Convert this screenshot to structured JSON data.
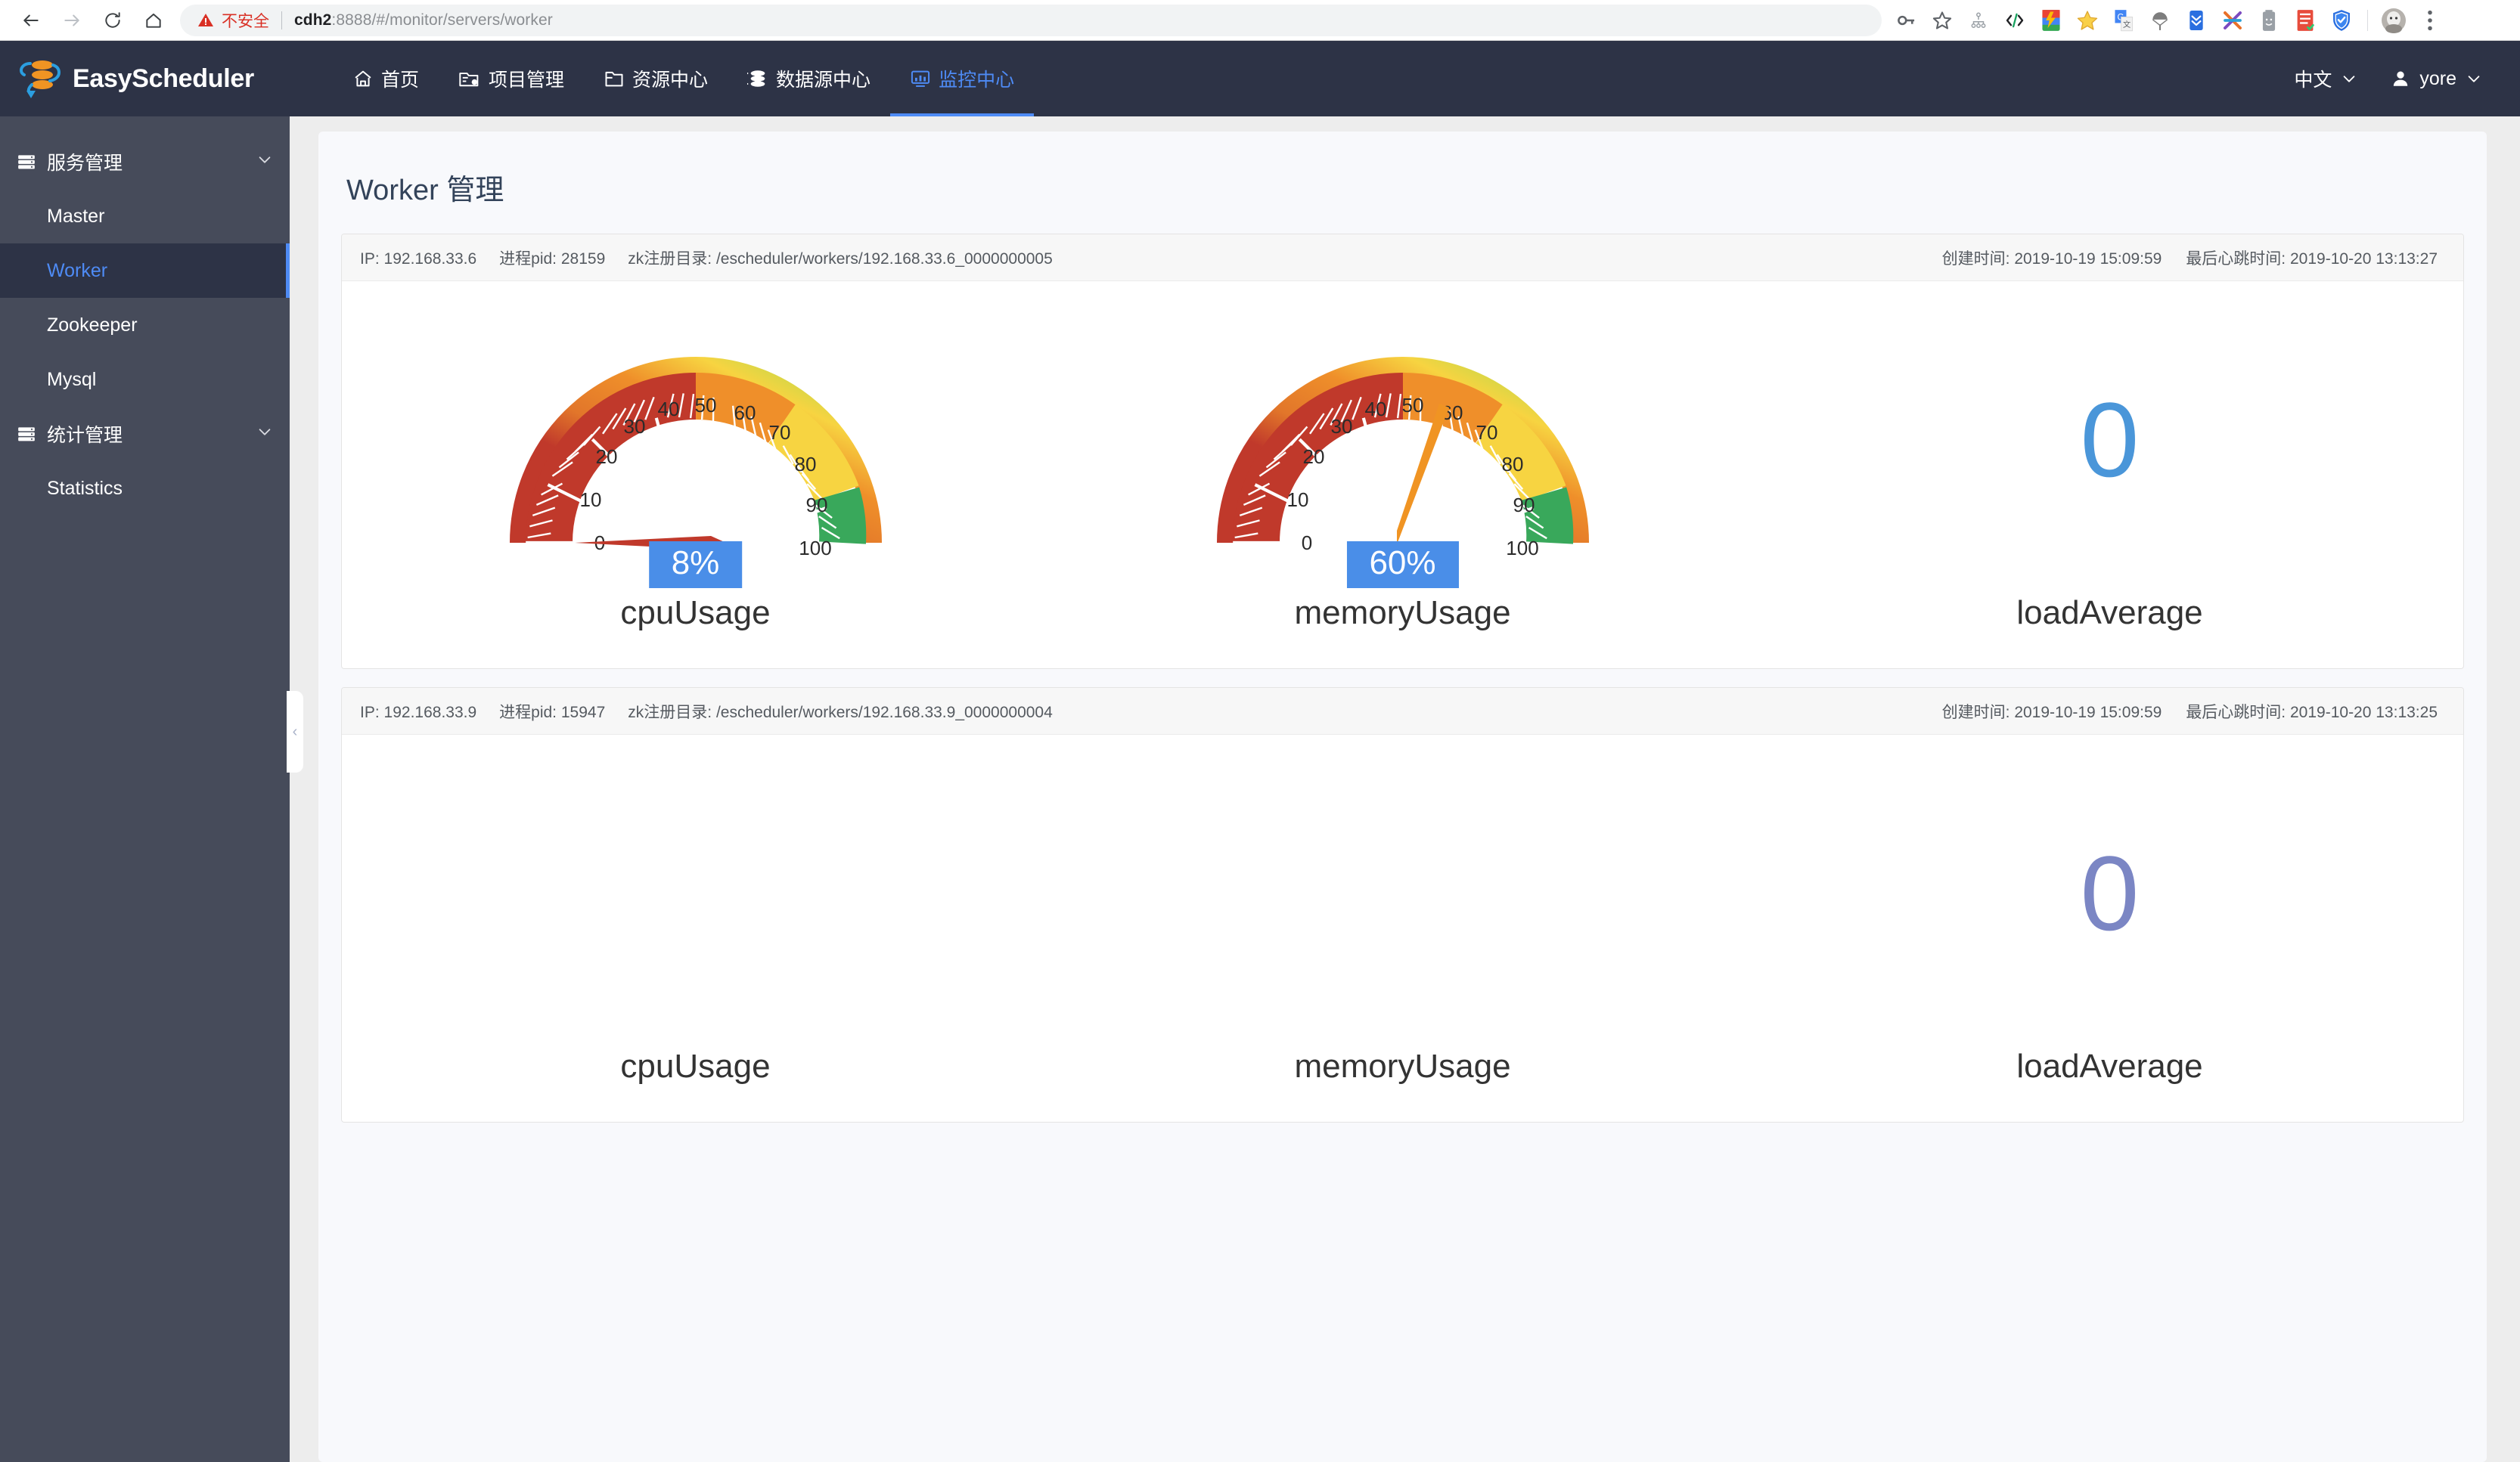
{
  "browser": {
    "back_icon": "back-arrow-icon",
    "forward_icon": "forward-arrow-icon",
    "reload_icon": "reload-icon",
    "home_icon": "home-icon",
    "security_label": "不安全",
    "url_host": "cdh2",
    "url_rest": ":8888/#/monitor/servers/worker",
    "extensions": [
      {
        "name": "password-key-icon",
        "color": "#5f6368"
      },
      {
        "name": "bookmark-star-icon",
        "color": "#5f6368"
      },
      {
        "name": "sitemap-icon",
        "color": "#9aa0a6"
      },
      {
        "name": "code-brackets-icon",
        "color": "#202124"
      },
      {
        "name": "colorzilla-extension-icon",
        "color": "#ea4335"
      },
      {
        "name": "star-extension-icon",
        "color": "#f6c443"
      },
      {
        "name": "google-translate-icon",
        "color": "#4285f4"
      },
      {
        "name": "parachute-extension-icon",
        "color": "#6b6b6b"
      },
      {
        "name": "download-chevrons-icon",
        "color": "#2a6fe0"
      },
      {
        "name": "x-scissors-extension-icon",
        "color": "#e86c2b"
      },
      {
        "name": "battery-extension-icon",
        "color": "#9aa0a6"
      },
      {
        "name": "notes-extension-icon",
        "color": "#e74c3c"
      },
      {
        "name": "shield-extension-icon",
        "color": "#2a6fe0"
      }
    ],
    "avatar_icon": "profile-avatar-icon",
    "menu_icon": "three-dot-menu-icon"
  },
  "header": {
    "brand": "EasyScheduler",
    "nav": [
      {
        "label": "首页",
        "icon": "home-icon",
        "active": false
      },
      {
        "label": "项目管理",
        "icon": "project-folder-gear-icon",
        "active": false
      },
      {
        "label": "资源中心",
        "icon": "folder-icon",
        "active": false
      },
      {
        "label": "数据源中心",
        "icon": "database-icon",
        "active": false
      },
      {
        "label": "监控中心",
        "icon": "monitor-screen-icon",
        "active": true
      }
    ],
    "language": "中文",
    "user": "yore",
    "accent_color": "#4e8bf5",
    "bg_color": "#2d3346"
  },
  "sidebar": {
    "groups": [
      {
        "label": "服务管理",
        "icon": "server-rack-icon",
        "items": [
          {
            "label": "Master",
            "active": false
          },
          {
            "label": "Worker",
            "active": true
          },
          {
            "label": "Zookeeper",
            "active": false
          },
          {
            "label": "Mysql",
            "active": false
          }
        ]
      },
      {
        "label": "统计管理",
        "icon": "server-rack-icon",
        "items": [
          {
            "label": "Statistics",
            "active": false
          }
        ]
      }
    ],
    "collapse_handle": "‹"
  },
  "main": {
    "title": "Worker 管理",
    "labels": {
      "ip": "IP:",
      "pid": "进程pid:",
      "zk": "zk注册目录:",
      "created": "创建时间:",
      "heartbeat": "最后心跳时间:"
    },
    "workers": [
      {
        "ip": "192.168.33.6",
        "pid": "28159",
        "zk_path": "/escheduler/workers/192.168.33.6_0000000005",
        "created_time": "2019-10-19 15:09:59",
        "last_heartbeat": "2019-10-20 13:13:27",
        "metrics": [
          {
            "name": "cpuUsage",
            "value": 8,
            "display": "8%",
            "type": "gauge",
            "needle_color": "#c0392b"
          },
          {
            "name": "memoryUsage",
            "value": 60,
            "display": "60%",
            "type": "gauge",
            "needle_color": "#f09423"
          },
          {
            "name": "loadAverage",
            "value": "0",
            "display": "0",
            "type": "number",
            "color": "#4a96d9"
          }
        ]
      },
      {
        "ip": "192.168.33.9",
        "pid": "15947",
        "zk_path": "/escheduler/workers/192.168.33.9_0000000004",
        "created_time": "2019-10-19 15:09:59",
        "last_heartbeat": "2019-10-20 13:13:25",
        "metrics": [
          {
            "name": "cpuUsage",
            "value": null,
            "display": "",
            "type": "empty",
            "needle_color": ""
          },
          {
            "name": "memoryUsage",
            "value": null,
            "display": "",
            "type": "empty",
            "needle_color": ""
          },
          {
            "name": "loadAverage",
            "value": "0",
            "display": "0",
            "type": "number",
            "color": "#7b86c4"
          }
        ]
      }
    ]
  },
  "chart_data": [
    {
      "type": "gauge",
      "title": "cpuUsage",
      "worker": "192.168.33.6",
      "value": 8,
      "display": "8%",
      "min": 0,
      "max": 100,
      "tick_labels": [
        0,
        10,
        20,
        30,
        40,
        50,
        60,
        70,
        80,
        90,
        100
      ],
      "start_angle": 210,
      "end_angle": -30,
      "bands": [
        {
          "from": 0,
          "to": 50,
          "color": "#c0392b"
        },
        {
          "from": 50,
          "to": 70,
          "color": "#ef8f2a"
        },
        {
          "from": 70,
          "to": 90,
          "color": "#f7d441"
        },
        {
          "from": 90,
          "to": 100,
          "color": "#39a85b"
        }
      ]
    },
    {
      "type": "gauge",
      "title": "memoryUsage",
      "worker": "192.168.33.6",
      "value": 60,
      "display": "60%",
      "min": 0,
      "max": 100,
      "tick_labels": [
        0,
        10,
        20,
        30,
        40,
        50,
        60,
        70,
        80,
        90,
        100
      ],
      "start_angle": 210,
      "end_angle": -30,
      "bands": [
        {
          "from": 0,
          "to": 50,
          "color": "#c0392b"
        },
        {
          "from": 50,
          "to": 70,
          "color": "#ef8f2a"
        },
        {
          "from": 70,
          "to": 90,
          "color": "#f7d441"
        },
        {
          "from": 90,
          "to": 100,
          "color": "#39a85b"
        }
      ]
    },
    {
      "type": "number",
      "title": "loadAverage",
      "worker": "192.168.33.6",
      "value": 0,
      "display": "0"
    },
    {
      "type": "number",
      "title": "loadAverage",
      "worker": "192.168.33.9",
      "value": 0,
      "display": "0"
    }
  ]
}
